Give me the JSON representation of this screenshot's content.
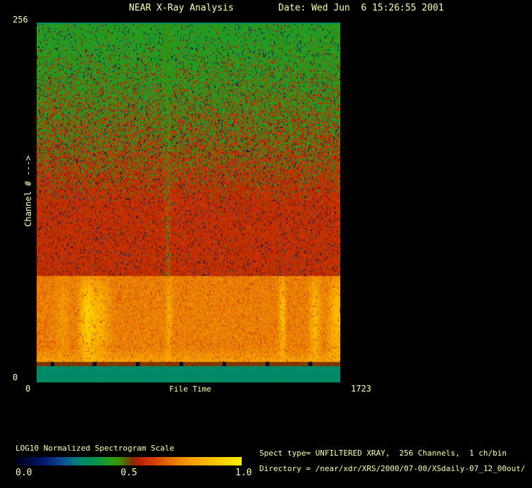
{
  "window": {
    "bg_color": "#000000",
    "text_color": "#ffffb2"
  },
  "header": {
    "title": "NEAR X-Ray Analysis",
    "date_label": "Date: Wed Jun  6 15:26:55 2001"
  },
  "plot": {
    "y_axis": {
      "label": "Channel # --->",
      "max_tick": "256",
      "min_tick": "0"
    },
    "x_axis": {
      "label": "File Time",
      "min_tick": "0",
      "max_tick": "1723"
    }
  },
  "colorbar": {
    "title": "LOG10 Normalized Spectrogram Scale",
    "ticks": [
      "0.0",
      "0.5",
      "1.0"
    ]
  },
  "info": {
    "spect_type_line": "Spect type= UNFILTERED XRAY,  256 Channels,  1 ch/bin",
    "directory_line": "Directory = /near/xdr/XRS/2000/07-00/XSdaily-07_12_00out/"
  },
  "chart_data": {
    "type": "heatmap",
    "title": "NEAR X-Ray Analysis spectrogram",
    "xlabel": "File Time",
    "ylabel": "Channel #",
    "xlim": [
      0,
      1723
    ],
    "ylim": [
      0,
      256
    ],
    "grid": false,
    "colorbar": {
      "label": "LOG10 Normalized Spectrogram Scale",
      "range": [
        0.0,
        1.0
      ],
      "position": "bottom-left"
    },
    "colormap_stops": [
      [
        0.0,
        "#000018"
      ],
      [
        0.06,
        "#000840"
      ],
      [
        0.12,
        "#001870"
      ],
      [
        0.2,
        "#104890"
      ],
      [
        0.26,
        "#087888"
      ],
      [
        0.3,
        "#008a66"
      ],
      [
        0.36,
        "#069648"
      ],
      [
        0.42,
        "#28a01e"
      ],
      [
        0.46,
        "#3c8c00"
      ],
      [
        0.5,
        "#6a5000"
      ],
      [
        0.52,
        "#8c2400"
      ],
      [
        0.56,
        "#c02800"
      ],
      [
        0.62,
        "#d84400"
      ],
      [
        0.68,
        "#e46c00"
      ],
      [
        0.72,
        "#ec8808"
      ],
      [
        0.8,
        "#f8a800"
      ],
      [
        0.9,
        "#ffcc00"
      ],
      [
        1.0,
        "#ffec00"
      ]
    ],
    "bands": [
      {
        "name": "top-teal",
        "ch_top": 256,
        "ch_bottom": 255.2,
        "mode": "flat",
        "value": 0.3,
        "jitter": 0.004
      },
      {
        "name": "mix",
        "ch_top": 255.2,
        "ch_bottom": 76,
        "mode": "mix",
        "green_value": 0.415,
        "red_value": 0.57,
        "full_red_ch": 127,
        "p_min": 0.03,
        "jitter": 0.035,
        "speckle_p": 0.05,
        "speckle_range": [
          0.0,
          0.22
        ],
        "alt_speckle_p": 0.02,
        "alt_speckle_range": [
          0.44,
          0.5
        ]
      },
      {
        "name": "orange",
        "ch_top": 76,
        "ch_bottom": 14.5,
        "mode": "flat",
        "value": 0.71,
        "jitter": 0.045,
        "speckle_p": 0.04,
        "speckle_range": [
          0.57,
          0.62
        ],
        "fringe_ch": 24,
        "fringe_add": 0.07
      },
      {
        "name": "dark-row",
        "ch_top": 14.5,
        "ch_bottom": 12,
        "mode": "flat",
        "value": 0.515,
        "jitter": 0.02
      },
      {
        "name": "bottom-teal",
        "ch_top": 12,
        "ch_bottom": 0,
        "mode": "flat",
        "value": 0.3,
        "jitter": 0.004
      }
    ],
    "streaks": [
      {
        "band": "mix",
        "t": 745,
        "w": 18,
        "strength": 0.12
      },
      {
        "band": "orange",
        "t": 150,
        "w": 35,
        "strength": 0.05
      },
      {
        "band": "orange",
        "t": 290,
        "w": 42,
        "strength": 0.2
      },
      {
        "band": "orange",
        "t": 365,
        "w": 45,
        "strength": 0.11
      },
      {
        "band": "orange",
        "t": 750,
        "w": 18,
        "strength": 0.09
      },
      {
        "band": "orange",
        "t": 1395,
        "w": 18,
        "strength": 0.15
      },
      {
        "band": "orange",
        "t": 1580,
        "w": 28,
        "strength": 0.13
      },
      {
        "band": "orange",
        "t": 1705,
        "w": 45,
        "strength": 0.14
      }
    ],
    "dropouts": [
      90,
      330,
      575,
      820,
      1065,
      1310,
      1555
    ]
  }
}
